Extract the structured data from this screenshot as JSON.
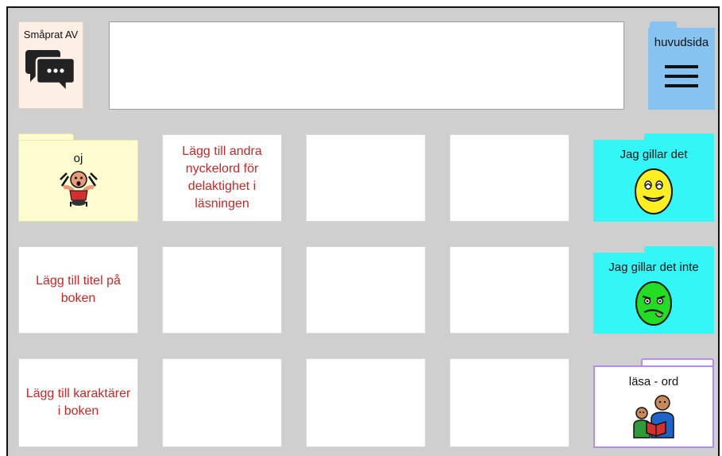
{
  "top": {
    "chat_button_label": "Småprat AV",
    "message_text": "",
    "home_button_label": "huvudsida"
  },
  "grid": {
    "oj_label": "oj",
    "add_keywords_text": "Lägg till andra nyckelord för delaktighet i läsningen",
    "add_title_text": "Lägg till titel på boken",
    "add_characters_text": "Lägg till karaktärer i boken",
    "like_label": "Jag gillar det",
    "dislike_label": "Jag gillar det inte",
    "read_words_label": "läsa - ord"
  },
  "colors": {
    "background": "#cfcfcf",
    "oj_folder": "#fdfdcf",
    "like_folder": "#33f7f7",
    "home_folder": "#86c3f0",
    "read_folder_border": "#b48cf0",
    "red_text": "#c62828"
  },
  "icons": {
    "chat": "speech-bubbles-icon",
    "home": "hamburger-menu-icon",
    "oj": "surprised-person-icon",
    "like": "happy-face-icon",
    "dislike": "disgusted-face-icon",
    "read": "reading-together-icon"
  }
}
